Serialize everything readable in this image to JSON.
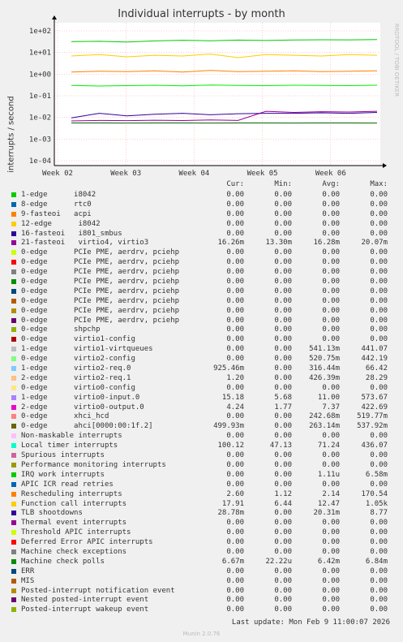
{
  "chart_data": {
    "type": "line",
    "title": "Individual interrupts - by month",
    "ylabel": "interrupts / second",
    "yscale": "log",
    "ylim": [
      0.0001,
      200
    ],
    "ytick_labels": [
      "1e+02",
      "1e+01",
      "1e+00",
      "1e-01",
      "1e-02",
      "1e-03",
      "1e-04"
    ],
    "xtick_labels": [
      "Week 02",
      "Week 03",
      "Week 04",
      "Week 05",
      "Week 06"
    ],
    "grid": true,
    "series": [
      {
        "name": "Local timer interrupts",
        "color": "#00cc00",
        "values": [
          60,
          62,
          58,
          65,
          70,
          66,
          71,
          68,
          72,
          74,
          73,
          75
        ]
      },
      {
        "name": "Function call interrupts",
        "color": "#ffcc00",
        "values": [
          12,
          14,
          11,
          13,
          12,
          15,
          10,
          14,
          13,
          12,
          14,
          13
        ]
      },
      {
        "name": "21-fasteoi virtio4, virtio3",
        "color": "#990099",
        "values": [
          0.0085,
          0.009,
          0.0088,
          0.0092,
          0.0089,
          0.0095,
          0.009,
          0.025,
          0.022,
          0.024,
          0.023,
          0.025
        ]
      },
      {
        "name": "TLB shootdowns",
        "color": "#330099",
        "values": [
          0.012,
          0.02,
          0.015,
          0.018,
          0.02,
          0.017,
          0.019,
          0.02,
          0.02,
          0.021,
          0.02,
          0.022
        ]
      },
      {
        "name": "Machine check polls",
        "color": "#006600",
        "values": [
          0.0068,
          0.0068,
          0.0067,
          0.0068,
          0.0068,
          0.0067,
          0.0068,
          0.0068,
          0.0067,
          0.0068,
          0.0068,
          0.0067
        ]
      },
      {
        "name": "0-edge virtio2-config",
        "color": "#00ee00",
        "values": [
          0.45,
          0.42,
          0.44,
          0.46,
          0.43,
          0.47,
          0.45,
          0.44,
          0.46,
          0.45,
          0.44,
          0.46
        ]
      },
      {
        "name": "Rescheduling interrupts",
        "color": "#ff8000",
        "values": [
          2.0,
          2.2,
          2.1,
          2.3,
          2.0,
          2.4,
          2.1,
          2.2,
          2.3,
          2.1,
          2.2,
          2.3
        ]
      }
    ],
    "legend": {
      "columns": [
        "Cur:",
        "Min:",
        "Avg:",
        "Max:"
      ],
      "rows": [
        {
          "color": "#00cc00",
          "name": "1-edge      i8042",
          "cur": "0.00",
          "min": "0.00",
          "avg": "0.00",
          "max": "0.00"
        },
        {
          "color": "#0066b3",
          "name": "8-edge      rtc0",
          "cur": "0.00",
          "min": "0.00",
          "avg": "0.00",
          "max": "0.00"
        },
        {
          "color": "#ff8000",
          "name": "9-fasteoi   acpi",
          "cur": "0.00",
          "min": "0.00",
          "avg": "0.00",
          "max": "0.00"
        },
        {
          "color": "#ffcc00",
          "name": "12-edge      i8042",
          "cur": "0.00",
          "min": "0.00",
          "avg": "0.00",
          "max": "0.00"
        },
        {
          "color": "#330099",
          "name": "16-fasteoi   i801_smbus",
          "cur": "0.00",
          "min": "0.00",
          "avg": "0.00",
          "max": "0.00"
        },
        {
          "color": "#990099",
          "name": "21-fasteoi   virtio4, virtio3",
          "cur": "16.26m",
          "min": "13.30m",
          "avg": "16.28m",
          "max": "20.07m"
        },
        {
          "color": "#ccff00",
          "name": "0-edge      PCIe PME, aerdrv, pciehp",
          "cur": "0.00",
          "min": "0.00",
          "avg": "0.00",
          "max": "0.00"
        },
        {
          "color": "#ff0000",
          "name": "0-edge      PCIe PME, aerdrv, pciehp",
          "cur": "0.00",
          "min": "0.00",
          "avg": "0.00",
          "max": "0.00"
        },
        {
          "color": "#808080",
          "name": "0-edge      PCIe PME, aerdrv, pciehp",
          "cur": "0.00",
          "min": "0.00",
          "avg": "0.00",
          "max": "0.00"
        },
        {
          "color": "#008f00",
          "name": "0-edge      PCIe PME, aerdrv, pciehp",
          "cur": "0.00",
          "min": "0.00",
          "avg": "0.00",
          "max": "0.00"
        },
        {
          "color": "#00487d",
          "name": "0-edge      PCIe PME, aerdrv, pciehp",
          "cur": "0.00",
          "min": "0.00",
          "avg": "0.00",
          "max": "0.00"
        },
        {
          "color": "#b35a00",
          "name": "0-edge      PCIe PME, aerdrv, pciehp",
          "cur": "0.00",
          "min": "0.00",
          "avg": "0.00",
          "max": "0.00"
        },
        {
          "color": "#b38f00",
          "name": "0-edge      PCIe PME, aerdrv, pciehp",
          "cur": "0.00",
          "min": "0.00",
          "avg": "0.00",
          "max": "0.00"
        },
        {
          "color": "#6b006b",
          "name": "0-edge      PCIe PME, aerdrv, pciehp",
          "cur": "0.00",
          "min": "0.00",
          "avg": "0.00",
          "max": "0.00"
        },
        {
          "color": "#8fb300",
          "name": "0-edge      shpchp",
          "cur": "0.00",
          "min": "0.00",
          "avg": "0.00",
          "max": "0.00"
        },
        {
          "color": "#b30000",
          "name": "0-edge      virtio1-config",
          "cur": "0.00",
          "min": "0.00",
          "avg": "0.00",
          "max": "0.00"
        },
        {
          "color": "#bebebe",
          "name": "1-edge      virtio1-virtqueues",
          "cur": "0.00",
          "min": "0.00",
          "avg": "541.13m",
          "max": "441.07"
        },
        {
          "color": "#80ff80",
          "name": "0-edge      virtio2-config",
          "cur": "0.00",
          "min": "0.00",
          "avg": "520.75m",
          "max": "442.19"
        },
        {
          "color": "#80c9ff",
          "name": "1-edge      virtio2-req.0",
          "cur": "925.46m",
          "min": "0.00",
          "avg": "316.44m",
          "max": "66.42"
        },
        {
          "color": "#ffc080",
          "name": "2-edge      virtio2-req.1",
          "cur": "1.20",
          "min": "0.00",
          "avg": "426.39m",
          "max": "28.29"
        },
        {
          "color": "#ffe680",
          "name": "0-edge      virtio0-config",
          "cur": "0.00",
          "min": "0.00",
          "avg": "0.00",
          "max": "0.00"
        },
        {
          "color": "#aa80ff",
          "name": "1-edge      virtio0-input.0",
          "cur": "15.18",
          "min": "5.68",
          "avg": "11.00",
          "max": "573.67"
        },
        {
          "color": "#ee00cc",
          "name": "2-edge      virtio0-output.0",
          "cur": "4.24",
          "min": "1.77",
          "avg": "7.37",
          "max": "422.69"
        },
        {
          "color": "#ff8080",
          "name": "0-edge      xhci_hcd",
          "cur": "0.00",
          "min": "0.00",
          "avg": "242.68m",
          "max": "519.77m"
        },
        {
          "color": "#666600",
          "name": "0-edge      ahci[0000:00:1f.2]",
          "cur": "499.93m",
          "min": "0.00",
          "avg": "263.14m",
          "max": "537.92m"
        },
        {
          "color": "#ffbfff",
          "name": "Non-maskable interrupts",
          "cur": "0.00",
          "min": "0.00",
          "avg": "0.00",
          "max": "0.00"
        },
        {
          "color": "#00ffcc",
          "name": "Local timer interrupts",
          "cur": "100.12",
          "min": "47.13",
          "avg": "71.24",
          "max": "436.07"
        },
        {
          "color": "#cc6699",
          "name": "Spurious interrupts",
          "cur": "0.00",
          "min": "0.00",
          "avg": "0.00",
          "max": "0.00"
        },
        {
          "color": "#999900",
          "name": "Performance monitoring interrupts",
          "cur": "0.00",
          "min": "0.00",
          "avg": "0.00",
          "max": "0.00"
        },
        {
          "color": "#00cc00",
          "name": "IRQ work interrupts",
          "cur": "0.00",
          "min": "0.00",
          "avg": "1.11u",
          "max": "6.58m"
        },
        {
          "color": "#0066b3",
          "name": "APIC ICR read retries",
          "cur": "0.00",
          "min": "0.00",
          "avg": "0.00",
          "max": "0.00"
        },
        {
          "color": "#ff8000",
          "name": "Rescheduling interrupts",
          "cur": "2.60",
          "min": "1.12",
          "avg": "2.14",
          "max": "170.54"
        },
        {
          "color": "#ffcc00",
          "name": "Function call interrupts",
          "cur": "17.91",
          "min": "6.44",
          "avg": "12.47",
          "max": "1.05k"
        },
        {
          "color": "#330099",
          "name": "TLB shootdowns",
          "cur": "28.78m",
          "min": "0.00",
          "avg": "20.31m",
          "max": "8.77"
        },
        {
          "color": "#990099",
          "name": "Thermal event interrupts",
          "cur": "0.00",
          "min": "0.00",
          "avg": "0.00",
          "max": "0.00"
        },
        {
          "color": "#ccff00",
          "name": "Threshold APIC interrupts",
          "cur": "0.00",
          "min": "0.00",
          "avg": "0.00",
          "max": "0.00"
        },
        {
          "color": "#ff0000",
          "name": "Deferred Error APIC interrupts",
          "cur": "0.00",
          "min": "0.00",
          "avg": "0.00",
          "max": "0.00"
        },
        {
          "color": "#808080",
          "name": "Machine check exceptions",
          "cur": "0.00",
          "min": "0.00",
          "avg": "0.00",
          "max": "0.00"
        },
        {
          "color": "#008f00",
          "name": "Machine check polls",
          "cur": "6.67m",
          "min": "22.22u",
          "avg": "6.42m",
          "max": "6.84m"
        },
        {
          "color": "#00487d",
          "name": "ERR",
          "cur": "0.00",
          "min": "0.00",
          "avg": "0.00",
          "max": "0.00"
        },
        {
          "color": "#b35a00",
          "name": "MIS",
          "cur": "0.00",
          "min": "0.00",
          "avg": "0.00",
          "max": "0.00"
        },
        {
          "color": "#b38f00",
          "name": "Posted-interrupt notification event",
          "cur": "0.00",
          "min": "0.00",
          "avg": "0.00",
          "max": "0.00"
        },
        {
          "color": "#6b006b",
          "name": "Nested posted-interrupt event",
          "cur": "0.00",
          "min": "0.00",
          "avg": "0.00",
          "max": "0.00"
        },
        {
          "color": "#8fb300",
          "name": "Posted-interrupt wakeup event",
          "cur": "0.00",
          "min": "0.00",
          "avg": "0.00",
          "max": "0.00"
        }
      ]
    }
  },
  "last_update": "Last update: Mon Feb  9 11:00:07 2026",
  "side_label": "RRDTOOL / TOBI OETIKER",
  "footer": "Munin 2.0.76"
}
